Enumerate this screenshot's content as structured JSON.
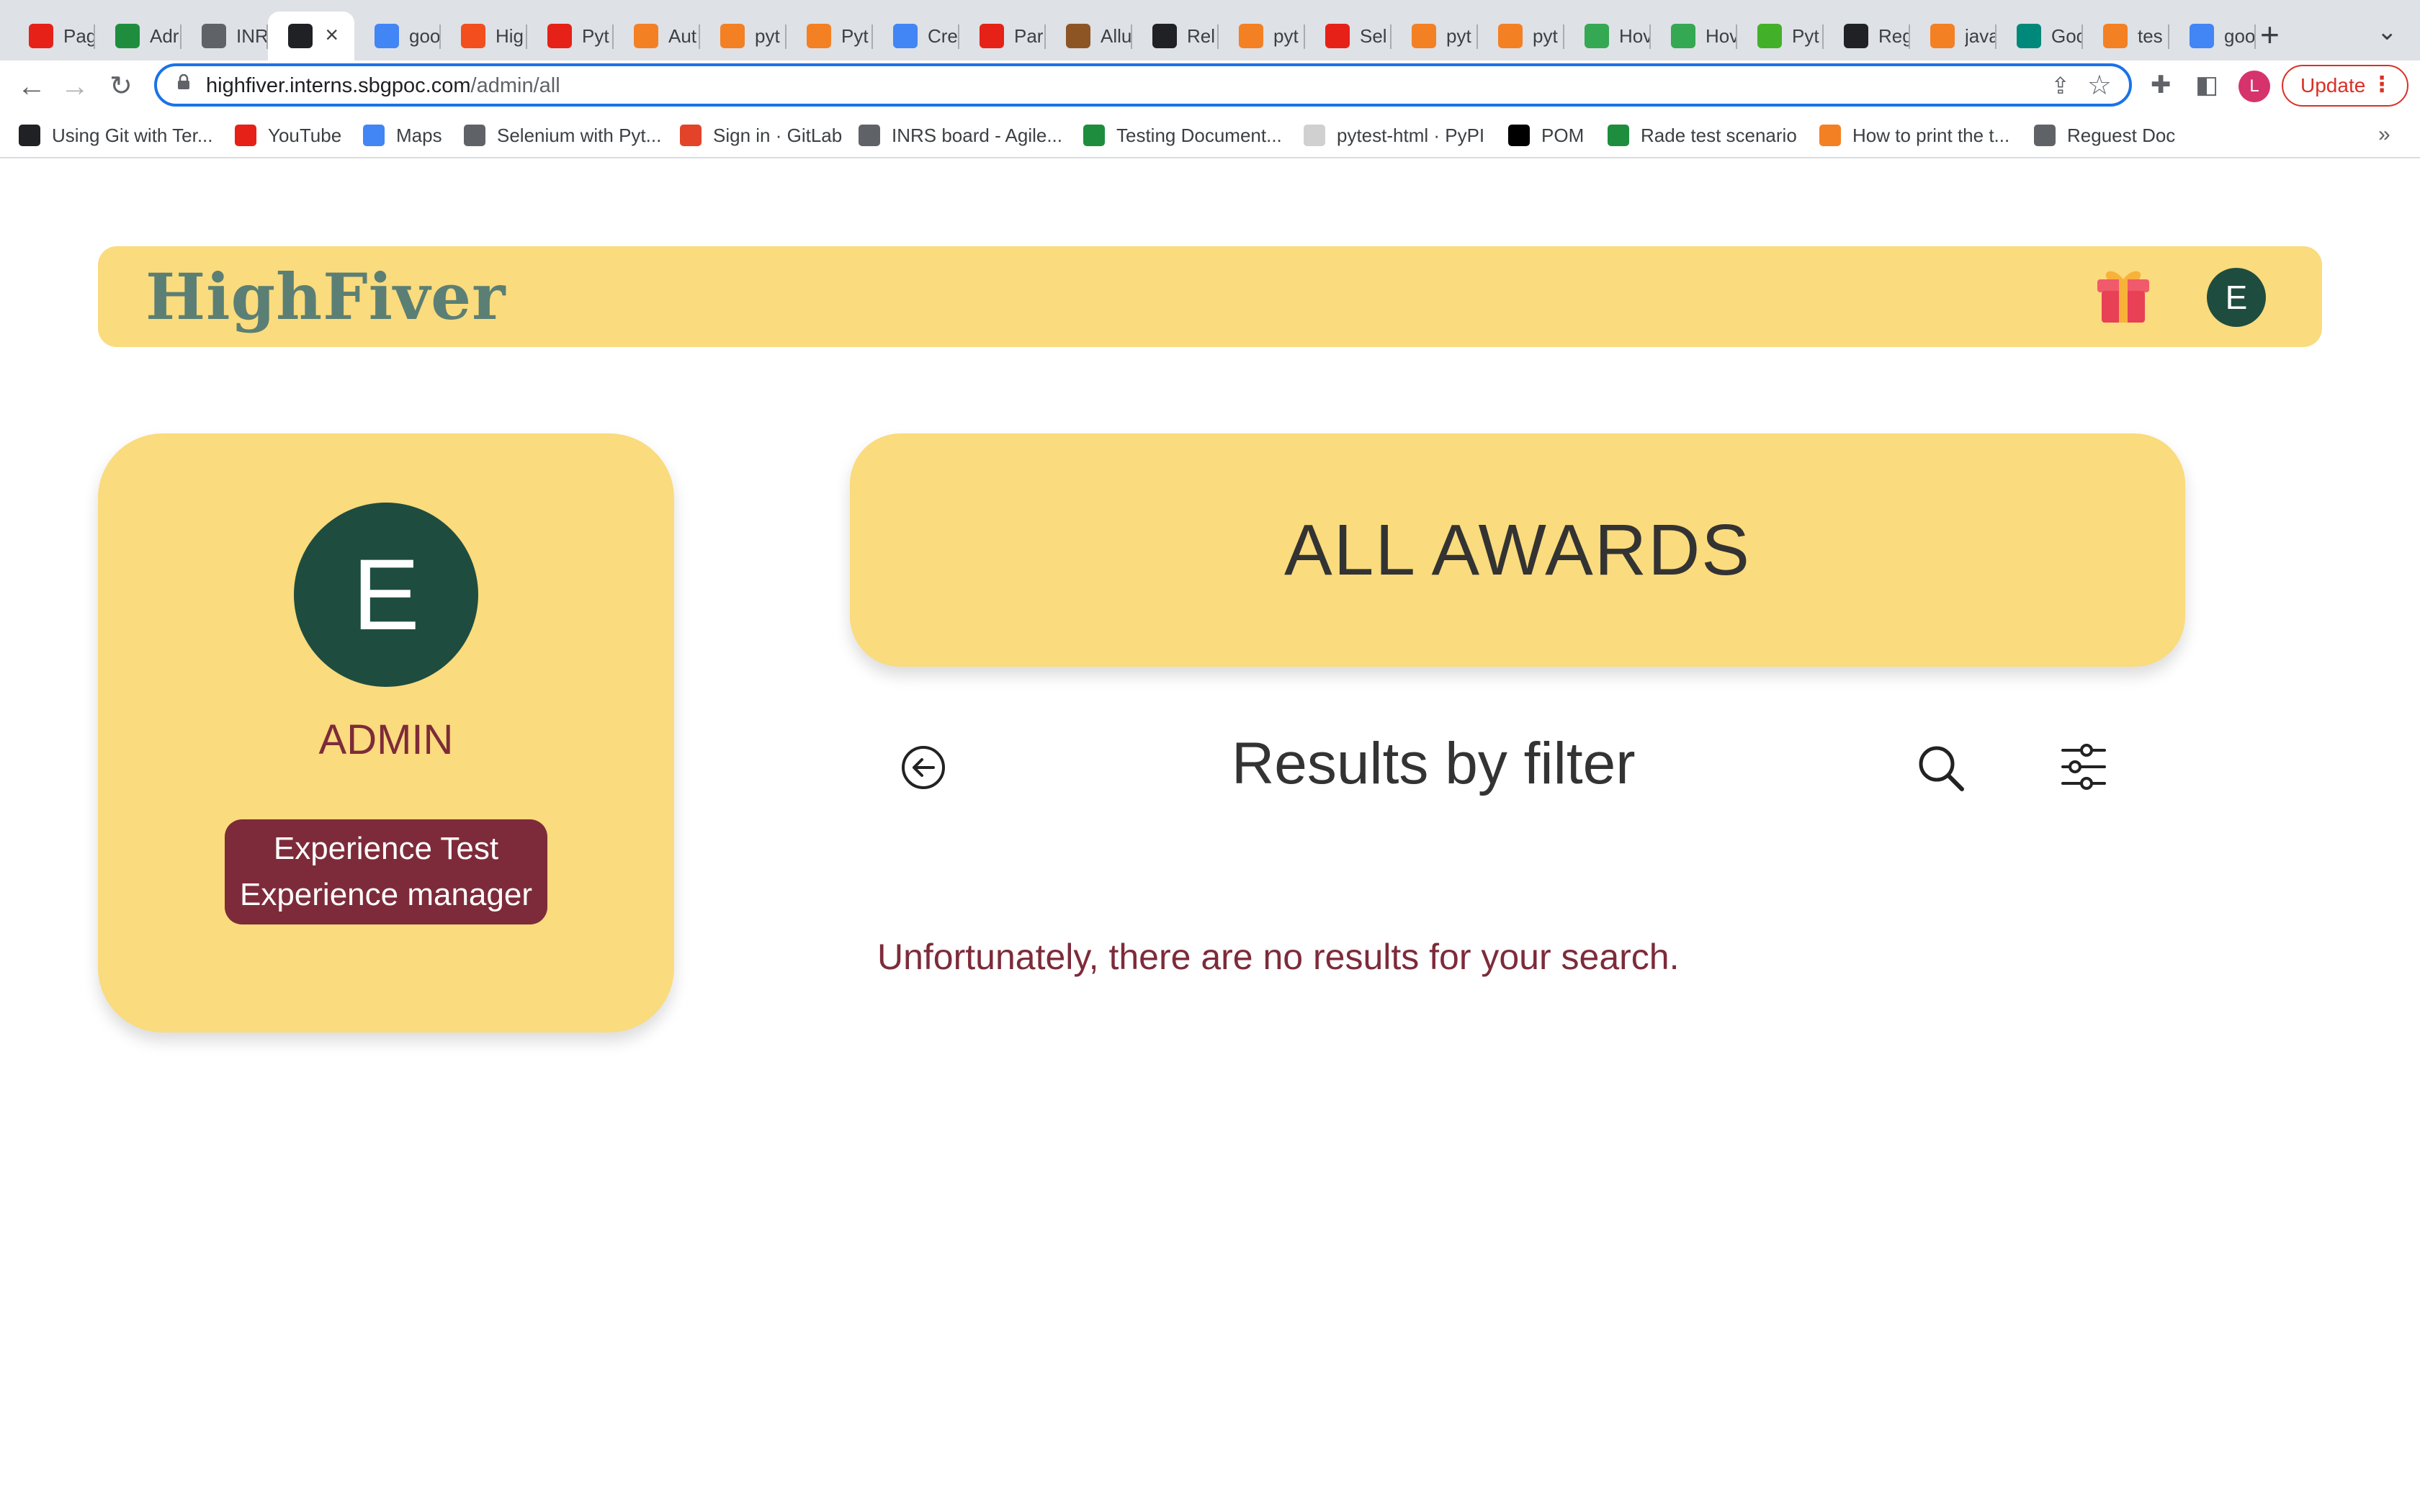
{
  "browser": {
    "tabs": [
      {
        "title": "Pag",
        "icon": "youtube-icon",
        "color": "#e62117"
      },
      {
        "title": "Adr",
        "icon": "google-sheets-icon",
        "color": "#1e8e3e"
      },
      {
        "title": "INR",
        "icon": "globe-icon",
        "color": "#5f6368"
      },
      {
        "title": "",
        "icon": "angular-icon",
        "color": "#202124"
      },
      {
        "title": "goo",
        "icon": "google-icon",
        "color": "#4285f4"
      },
      {
        "title": "Hig",
        "icon": "figma-icon",
        "color": "#f24e1e"
      },
      {
        "title": "Pyt",
        "icon": "youtube-icon",
        "color": "#e62117"
      },
      {
        "title": "Aut",
        "icon": "stackoverflow-icon",
        "color": "#f48024"
      },
      {
        "title": "pyt",
        "icon": "stackoverflow-icon",
        "color": "#f48024"
      },
      {
        "title": "Pyt",
        "icon": "stackoverflow-icon",
        "color": "#f48024"
      },
      {
        "title": "Cre",
        "icon": "code-icon",
        "color": "#4285f4"
      },
      {
        "title": "Par",
        "icon": "youtube-icon",
        "color": "#e62117"
      },
      {
        "title": "Allu",
        "icon": "allure-icon",
        "color": "#8d5524"
      },
      {
        "title": "Rel",
        "icon": "github-icon",
        "color": "#202124"
      },
      {
        "title": "pyt",
        "icon": "stackoverflow-icon",
        "color": "#f48024"
      },
      {
        "title": "Sel",
        "icon": "youtube-icon",
        "color": "#e62117"
      },
      {
        "title": "pyt",
        "icon": "stackoverflow-icon",
        "color": "#f48024"
      },
      {
        "title": "pyt",
        "icon": "stackoverflow-icon",
        "color": "#f48024"
      },
      {
        "title": "Hov",
        "icon": "fi-icon",
        "color": "#34a853"
      },
      {
        "title": "Hov",
        "icon": "fi-icon",
        "color": "#34a853"
      },
      {
        "title": "Pyt",
        "icon": "selenium-icon",
        "color": "#43b02a"
      },
      {
        "title": "Reg",
        "icon": "regex-icon",
        "color": "#202124"
      },
      {
        "title": "java",
        "icon": "stackoverflow-icon",
        "color": "#f48024"
      },
      {
        "title": "Goo",
        "icon": "google-meet-icon",
        "color": "#00897b"
      },
      {
        "title": "tes",
        "icon": "stackoverflow-icon",
        "color": "#f48024"
      },
      {
        "title": "goo",
        "icon": "google-icon",
        "color": "#4285f4"
      }
    ],
    "url_host": "highfiver.interns.sbgpoc.com",
    "url_path": "/admin/all",
    "update_label": "Update",
    "profile_initial": "L",
    "bookmarks": [
      {
        "label": "Using Git with Ter...",
        "icon": "c-icon",
        "color": "#202124"
      },
      {
        "label": "YouTube",
        "icon": "youtube-icon",
        "color": "#e62117"
      },
      {
        "label": "Maps",
        "icon": "google-icon",
        "color": "#4285f4"
      },
      {
        "label": "Selenium with Pyt...",
        "icon": "document-icon",
        "color": "#5f6368"
      },
      {
        "label": "Sign in · GitLab",
        "icon": "gitlab-icon",
        "color": "#e24329"
      },
      {
        "label": "INRS board - Agile...",
        "icon": "globe-icon",
        "color": "#5f6368"
      },
      {
        "label": "Testing Document...",
        "icon": "google-sheets-icon",
        "color": "#1e8e3e"
      },
      {
        "label": "pytest-html · PyPI",
        "icon": "pypi-icon",
        "color": "#d0d0d0"
      },
      {
        "label": "POM",
        "icon": "medium-icon",
        "color": "#000000"
      },
      {
        "label": "Rade test scenario",
        "icon": "google-sheets-icon",
        "color": "#1e8e3e"
      },
      {
        "label": "How to print the t...",
        "icon": "stackoverflow-icon",
        "color": "#f48024"
      },
      {
        "label": "Reguest Doc",
        "icon": "clipboard-icon",
        "color": "#5f6368"
      }
    ]
  },
  "app": {
    "logo": "HighFiver",
    "header_avatar_initial": "E",
    "colors": {
      "accent": "#fadb7d",
      "avatar": "#1e4d40",
      "maroon": "#7d2b3a"
    },
    "profile": {
      "initial": "E",
      "role": "ADMIN",
      "lines": [
        "Experience Test",
        "Experience manager"
      ]
    },
    "banner_title": "ALL AWARDS",
    "results_title": "Results by filter",
    "empty_message": "Unfortunately, there are no results for your search."
  }
}
